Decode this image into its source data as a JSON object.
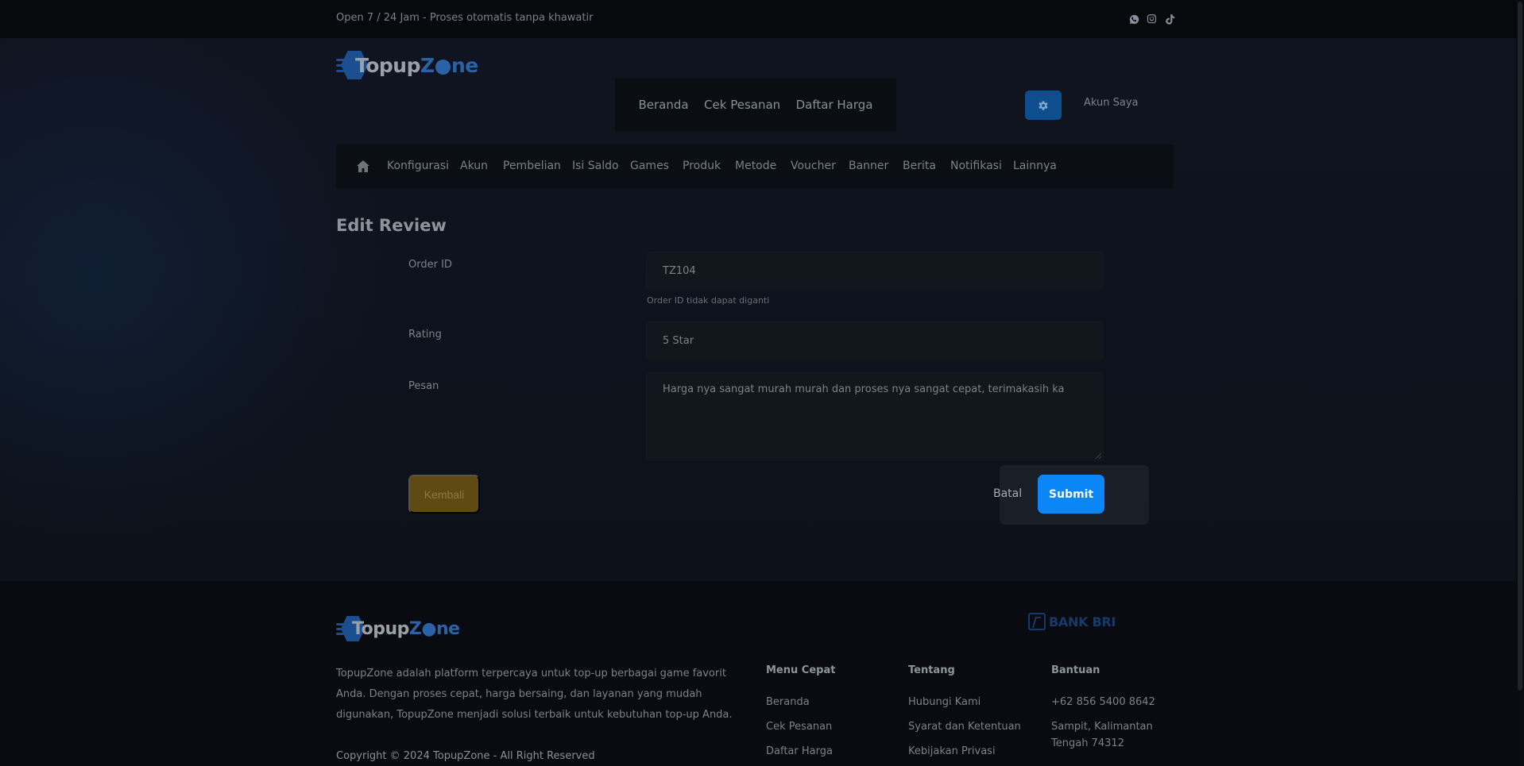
{
  "topbar": {
    "text": "Open 7 / 24 Jam - Proses otomatis tanpa khawatir",
    "social_icons": [
      "whatsapp-icon",
      "instagram-icon",
      "tiktok-icon"
    ]
  },
  "header": {
    "logo_part1": "Topup",
    "logo_part2": "Z",
    "logo_part3": "ne",
    "nav": [
      "Beranda",
      "Cek Pesanan",
      "Daftar Harga"
    ],
    "settings_icon": "gear-icon",
    "account_label": "Akun Saya"
  },
  "admin_nav": {
    "home_icon": "home-icon",
    "items": [
      "Konfigurasi",
      "Akun",
      "Pembelian",
      "Isi Saldo",
      "Games",
      "Produk",
      "Metode",
      "Voucher",
      "Banner",
      "Berita",
      "Notifikasi",
      "Lainnya"
    ]
  },
  "form": {
    "title": "Edit Review",
    "order_id": {
      "label": "Order ID",
      "value": "TZ104",
      "hint": "Order ID tidak dapat diganti"
    },
    "rating": {
      "label": "Rating",
      "value": "5 Star"
    },
    "message": {
      "label": "Pesan",
      "value": "Harga nya sangat murah murah dan proses nya sangat cepat, terimakasih ka"
    },
    "back_label": "Kembali",
    "cancel_label": "Batal",
    "submit_label": "Submit"
  },
  "footer": {
    "description": "TopupZone adalah platform terpercaya untuk top-up berbagai game favorit Anda. Dengan proses cepat, harga bersaing, dan layanan yang mudah digunakan, TopupZone menjadi solusi terbaik untuk kebutuhan top-up Anda.",
    "copyright": "Copyright © 2024 TopupZone - All Right Reserved",
    "bank": "BANK BRI",
    "menu_title": "Menu Cepat",
    "menu_links": [
      "Beranda",
      "Cek Pesanan",
      "Daftar Harga"
    ],
    "about_title": "Tentang",
    "about_links": [
      "Hubungi Kami",
      "Syarat dan Ketentuan",
      "Kebijakan Privasi"
    ],
    "help_title": "Bantuan",
    "help_phone": "+62 856 5400 8642",
    "help_address": "Sampit, Kalimantan Tengah 74312"
  },
  "colors": {
    "accent": "#0b86f6",
    "back_button": "#5f4a14",
    "brand_blue": "#2a62a8"
  }
}
